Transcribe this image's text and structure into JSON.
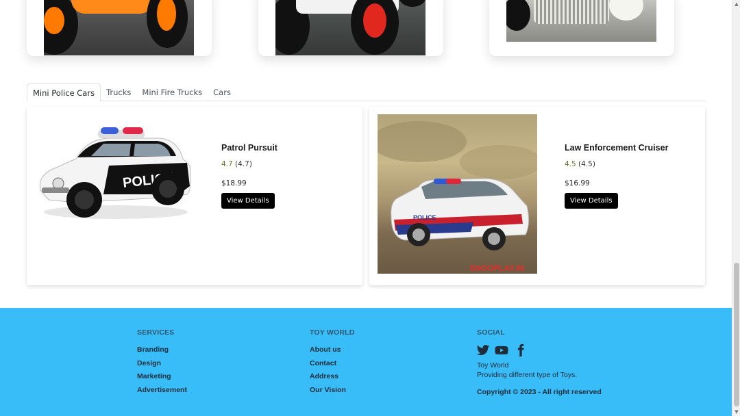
{
  "tabs": [
    {
      "label": "Mini Police Cars",
      "active": true
    },
    {
      "label": "Trucks",
      "active": false
    },
    {
      "label": "Mini Fire Trucks",
      "active": false
    },
    {
      "label": "Cars",
      "active": false
    }
  ],
  "products": [
    {
      "name": "Patrol Pursuit",
      "rating": "4.7",
      "rating_paren": "(4.7)",
      "price": "$18.99",
      "button": "View Details",
      "car_text": "POLICE"
    },
    {
      "name": "Law Enforcement Cruiser",
      "rating": "4.5",
      "rating_paren": "(4.5)",
      "price": "$16.99",
      "button": "View Details",
      "car_text": "POLICE",
      "watermark": "SNOOPLAY.IN"
    }
  ],
  "footer": {
    "services": {
      "heading": "SERVICES",
      "links": [
        "Branding",
        "Design",
        "Marketing",
        "Advertisement"
      ]
    },
    "toyworld": {
      "heading": "TOY WORLD",
      "links": [
        "About us",
        "Contact",
        "Address",
        "Our Vision"
      ]
    },
    "social": {
      "heading": "SOCIAL",
      "icons": [
        "twitter-icon",
        "youtube-icon",
        "facebook-icon"
      ],
      "brand": "Toy World",
      "tagline": "Providing different type of Toys.",
      "copyright": "Copyright © 2023 - All right reserved"
    }
  },
  "colors": {
    "footer_bg": "#38bdf8",
    "button_bg": "#000000",
    "rating": "#5a7a2a"
  }
}
